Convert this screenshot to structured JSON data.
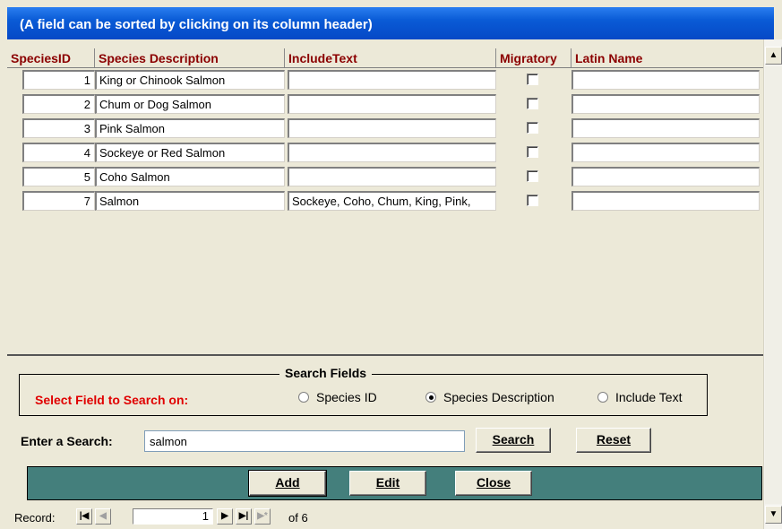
{
  "title": "(A field can be sorted by clicking on its column header)",
  "columns": [
    "SpeciesID",
    "Species Description",
    "IncludeText",
    "Migratory",
    "Latin Name"
  ],
  "rows": [
    {
      "id": "1",
      "description": "King or Chinook Salmon",
      "include_text": "",
      "migratory": false,
      "latin": ""
    },
    {
      "id": "2",
      "description": "Chum or Dog Salmon",
      "include_text": "",
      "migratory": false,
      "latin": ""
    },
    {
      "id": "3",
      "description": "Pink Salmon",
      "include_text": "",
      "migratory": false,
      "latin": ""
    },
    {
      "id": "4",
      "description": "Sockeye or Red Salmon",
      "include_text": "",
      "migratory": false,
      "latin": ""
    },
    {
      "id": "5",
      "description": "Coho Salmon",
      "include_text": "",
      "migratory": false,
      "latin": ""
    },
    {
      "id": "7",
      "description": "Salmon",
      "include_text": "Sockeye, Coho, Chum, King, Pink,",
      "migratory": false,
      "latin": ""
    }
  ],
  "search": {
    "frame_title": "Search Fields",
    "field_label": "Select Field to Search on:",
    "options": [
      {
        "label": "Species ID",
        "selected": false
      },
      {
        "label": "Species Description",
        "selected": true
      },
      {
        "label": "Include Text",
        "selected": false
      }
    ],
    "enter_label": "Enter a Search:",
    "value": "salmon",
    "search_button": "Search",
    "reset_button": "Reset"
  },
  "actions": {
    "add": "Add",
    "edit": "Edit",
    "close": "Close"
  },
  "navigator": {
    "label": "Record:",
    "current": "1",
    "of_text": "of 6"
  },
  "colors": {
    "title_bar": "#0a5bd6",
    "header_text": "#8b0000",
    "search_label": "#e00000",
    "action_bar": "#447f7c"
  }
}
